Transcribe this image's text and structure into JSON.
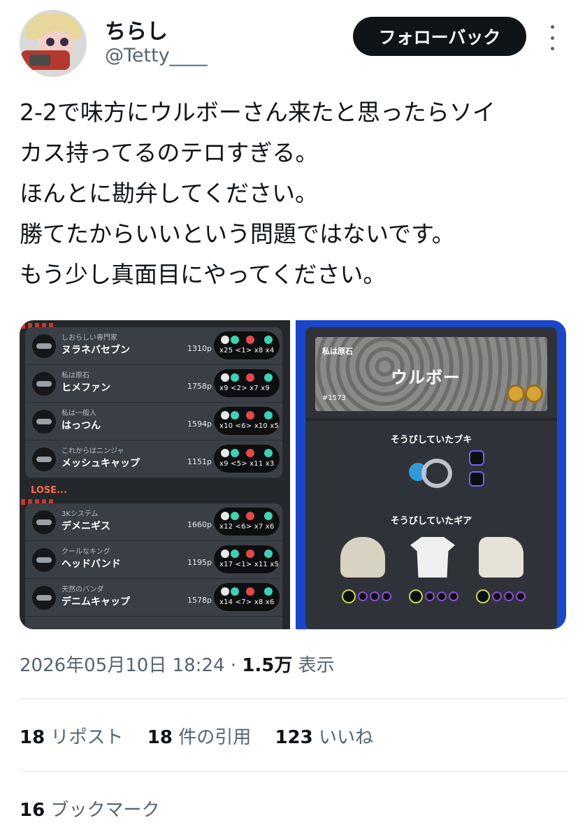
{
  "user": {
    "display_name": "ちらし",
    "handle": "@Tetty____",
    "follow_label": "フォローバック"
  },
  "tweet": {
    "lines": [
      "2-2で味方にウルボーさん来たと思ったらソイ",
      "カス持ってるのテロすぎる。",
      "ほんとに勘弁してください。",
      "勝てたからいいという問題ではないです。",
      "もう少し真面目にやってください。"
    ]
  },
  "scoreboard": {
    "win_rows": [
      {
        "title": "しおらしい専門家",
        "name": "ヌラネバセブン",
        "points": "1310p",
        "stats": "x25 <1>  x8  x4"
      },
      {
        "title": "私は原石",
        "name": "ヒメファン",
        "points": "1758p",
        "stats": "x9 <2>  x7  x9"
      },
      {
        "title": "私は一般人",
        "name": "はっつん",
        "points": "1594p",
        "stats": "x10 <6>  x10  x5"
      },
      {
        "title": "これからはニンジャ",
        "name": "メッシュキャップ",
        "points": "1151p",
        "stats": "x9 <5>  x11  x3"
      }
    ],
    "lose_label": "LOSE...",
    "lose_rows": [
      {
        "title": "3Kシステム",
        "name": "デメニギス",
        "points": "1660p",
        "stats": "x12 <6>  x7  x6"
      },
      {
        "title": "クールなキング",
        "name": "ヘッドバンド",
        "points": "1195p",
        "stats": "x17 <1>  x11  x5"
      },
      {
        "title": "天然のバンダ",
        "name": "デニムキャップ",
        "points": "1578p",
        "stats": "x14 <7>  x8  x6"
      }
    ]
  },
  "player_card": {
    "title": "私は原石",
    "name": "ウルボー",
    "number": "#1573",
    "weapon_label": "そうびしていたブキ",
    "gear_label": "そうびしていたギア"
  },
  "meta": {
    "timestamp": "2026年05月10日 18:24",
    "separator": "·",
    "views_count": "1.5万",
    "views_label": "表示"
  },
  "engagement": {
    "reposts_count": "18",
    "reposts_label": "リポスト",
    "quotes_count": "18",
    "quotes_label": "件の引用",
    "likes_count": "123",
    "likes_label": "いいね",
    "bookmarks_count": "16",
    "bookmarks_label": "ブックマーク"
  },
  "colors": {
    "follow_button": "#0f1419",
    "secondary_text": "#536471",
    "right_image_bg": "#1a47c9",
    "lose_label": "#ff6a4a"
  }
}
